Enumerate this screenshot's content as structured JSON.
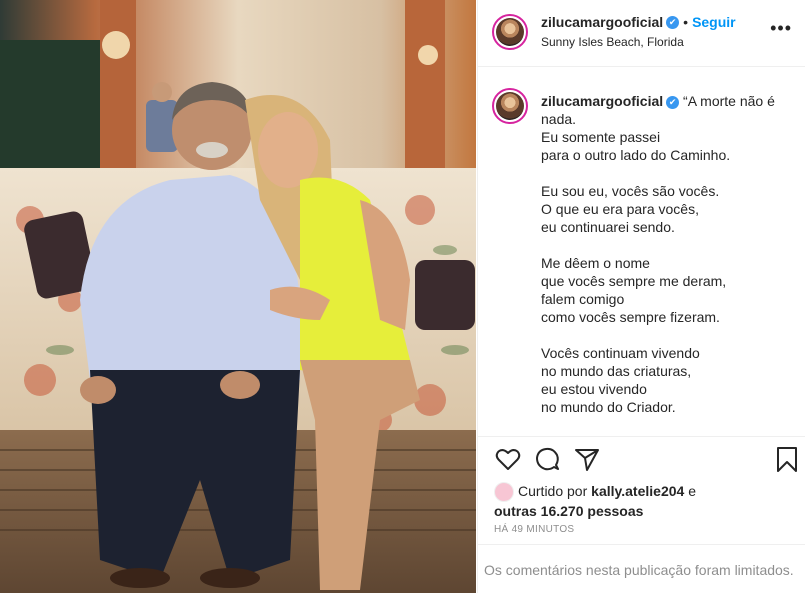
{
  "post": {
    "username": "zilucamargooficial",
    "verified_label": "✔",
    "dot": "•",
    "follow_label": "Seguir",
    "location": "Sunny Isles Beach, Florida",
    "more_label": "•••"
  },
  "caption": {
    "username": "zilucamargooficial",
    "text": " “A morte não é nada.\nEu somente passei\npara o outro lado do Caminho.\n\nEu sou eu, vocês são vocês.\nO que eu era para vocês,\neu continuarei sendo.\n\nMe dêem o nome\nque vocês sempre me deram,\nfalem comigo\ncomo vocês sempre fizeram.\n\nVocês continuam vivendo\nno mundo das criaturas,\neu estou vivendo\nno mundo do Criador."
  },
  "actions": {
    "icons": [
      "heart-icon",
      "comment-icon",
      "share-icon",
      "bookmark-icon"
    ]
  },
  "likes": {
    "prefix": "Curtido por ",
    "user": "kally.atelie204",
    "middle": " e",
    "others": "outras 16.270 pessoas"
  },
  "timestamp": "HÁ 49 MINUTOS",
  "comments_notice": "Os comentários nesta publicação foram limitados.",
  "colors": {
    "accent": "#0095f6",
    "verified": "#3897f0",
    "muted": "#8e8e8e",
    "border": "#efefef"
  }
}
